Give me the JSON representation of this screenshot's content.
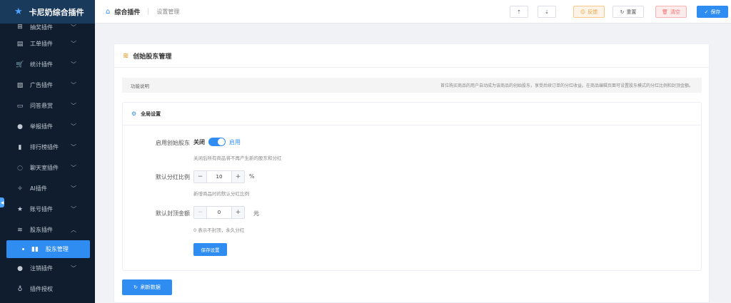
{
  "app": {
    "title": "卡尼奶综合插件"
  },
  "sidebar": {
    "items": [
      {
        "label": "抽奖插件",
        "icon": "gift-icon",
        "glyph": "⊞"
      },
      {
        "label": "工单插件",
        "icon": "document-icon",
        "glyph": "▤"
      },
      {
        "label": "统计插件",
        "icon": "cart-icon",
        "glyph": "🛒"
      },
      {
        "label": "广告插件",
        "icon": "image-icon",
        "glyph": "▨"
      },
      {
        "label": "问答悬赏",
        "icon": "chat-icon",
        "glyph": "▭"
      },
      {
        "label": "举报插件",
        "icon": "warning-icon",
        "glyph": "●"
      },
      {
        "label": "排行榜插件",
        "icon": "bar-chart-icon",
        "glyph": "▮"
      },
      {
        "label": "聊天室插件",
        "icon": "message-icon",
        "glyph": "◌"
      },
      {
        "label": "AI插件",
        "icon": "ai-icon",
        "glyph": "✧"
      },
      {
        "label": "账号插件",
        "icon": "star-icon",
        "glyph": "★"
      },
      {
        "label": "股东插件",
        "icon": "database-icon",
        "glyph": "≋"
      }
    ],
    "active_sub": {
      "label": "股东管理"
    },
    "after": [
      {
        "label": "注销插件",
        "icon": "user-icon",
        "glyph": "●"
      },
      {
        "label": "插件授权",
        "icon": "key-icon",
        "glyph": "♁"
      }
    ]
  },
  "header": {
    "breadcrumb": {
      "root": "综合插件",
      "current": "设置管理"
    },
    "buttons": {
      "upload": "⇡",
      "download": "⇣",
      "feedback": "反馈",
      "reset": "重置",
      "clear": "清空",
      "save": "保存"
    }
  },
  "panel": {
    "title": "创始股东管理",
    "desc_label": "功能说明",
    "desc_text": "首位购买商品的用户自动成为该商品的创始股东，享受后续订单的分红收益。在商品编辑页面可设置股东模式的分红比例和封顶金额。"
  },
  "settings": {
    "title": "全局设置",
    "enable": {
      "label": "启用创始股东",
      "off": "关闭",
      "on": "启用",
      "checked": true,
      "hint": "关闭后所有商品将不再产生新的股东和分红"
    },
    "ratio": {
      "label": "默认分红比例",
      "value": "10",
      "unit": "%",
      "hint": "新增商品时的默认分红比例"
    },
    "cap": {
      "label": "默认封顶金额",
      "value": "0",
      "unit": "元",
      "hint": "0 表示不封顶，永久分红"
    },
    "save_label": "保存设置"
  },
  "refresh_label": "刷新数据"
}
